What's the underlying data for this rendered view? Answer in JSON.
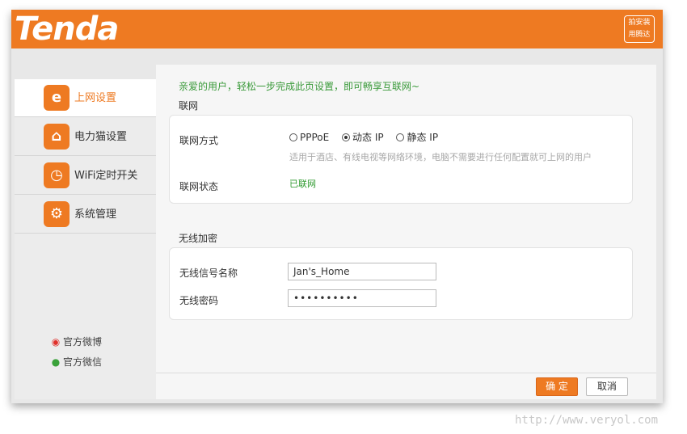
{
  "header": {
    "logo_text": "Tenda",
    "badge_line1": "拍安装",
    "badge_line2": "用腾达"
  },
  "sidebar": {
    "items": [
      {
        "label": "上网设置",
        "icon": "browser-icon",
        "active": true
      },
      {
        "label": "电力猫设置",
        "icon": "home-icon",
        "active": false
      },
      {
        "label": "WiFi定时开关",
        "icon": "timer-icon",
        "active": false
      },
      {
        "label": "系统管理",
        "icon": "gear-icon",
        "active": false
      }
    ],
    "social": [
      {
        "label": "官方微博",
        "icon": "weibo-icon",
        "color": "#e0302b"
      },
      {
        "label": "官方微信",
        "icon": "wechat-icon",
        "color": "#3aa23a"
      }
    ]
  },
  "main": {
    "welcome": "亲爱的用户，轻松一步完成此页设置，即可畅享互联网~",
    "network": {
      "section_title": "联网",
      "mode_label": "联网方式",
      "modes": [
        {
          "label": "PPPoE",
          "selected": false
        },
        {
          "label": "动态 IP",
          "selected": true
        },
        {
          "label": "静态 IP",
          "selected": false
        }
      ],
      "hint": "适用于酒店、有线电视等网络环境，电脑不需要进行任何配置就可上网的用户",
      "status_label": "联网状态",
      "status_value": "已联网"
    },
    "wireless": {
      "section_title": "无线加密",
      "ssid_label": "无线信号名称",
      "ssid_value": "Jan's_Home",
      "password_label": "无线密码",
      "password_value": "••••••••••"
    },
    "buttons": {
      "ok": "确 定",
      "cancel": "取消"
    }
  },
  "watermark": "http://www.veryol.com",
  "colors": {
    "brand": "#ee7a22",
    "success": "#2e9a2e"
  }
}
